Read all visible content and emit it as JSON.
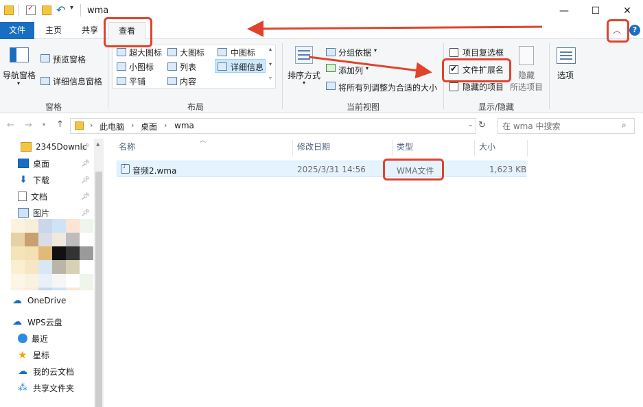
{
  "window": {
    "title": "wma",
    "minimize_glyph": "—",
    "maximize_glyph": "☐",
    "close_glyph": "✕"
  },
  "tabs": [
    {
      "label": "文件"
    },
    {
      "label": "主页"
    },
    {
      "label": "共享"
    },
    {
      "label": "查看"
    }
  ],
  "ribbon": {
    "panes": {
      "nav_pane": "导航窗格",
      "preview_pane": "预览窗格",
      "details_pane": "详细信息窗格",
      "label": "窗格"
    },
    "layout": {
      "items": [
        "超大图标",
        "大图标",
        "中图标",
        "小图标",
        "列表",
        "详细信息",
        "平铺",
        "内容"
      ],
      "label": "布局"
    },
    "current_view": {
      "sort_by": "排序方式",
      "group_by": "分组依据",
      "add_columns": "添加列",
      "fit_columns": "将所有列调整为合适的大小",
      "label": "当前视图"
    },
    "show_hide": {
      "item_checkboxes": "项目复选框",
      "file_extensions": "文件扩展名",
      "hidden_items": "隐藏的项目",
      "hide_selected_line1": "隐藏",
      "hide_selected_line2": "所选项目",
      "label": "显示/隐藏",
      "item_checkboxes_checked": false,
      "file_extensions_checked": true,
      "hidden_items_checked": false
    },
    "options": "选项"
  },
  "nav": {
    "breadcrumb": [
      "此电脑",
      "桌面",
      "wma"
    ],
    "search_placeholder": "在 wma 中搜索"
  },
  "sidebar": {
    "quick": [
      {
        "label": "2345Downlc",
        "icon": "folder-icon"
      },
      {
        "label": "桌面",
        "icon": "desktop-icon"
      },
      {
        "label": "下载",
        "icon": "download-icon"
      },
      {
        "label": "文档",
        "icon": "document-icon"
      },
      {
        "label": "图片",
        "icon": "pictures-icon"
      }
    ],
    "others": [
      {
        "label": "OneDrive",
        "icon": "cloud-icon"
      },
      {
        "label": "WPS云盘",
        "icon": "cloud-icon"
      },
      {
        "label": "最近",
        "icon": "clock-icon"
      },
      {
        "label": "星标",
        "icon": "star-icon"
      },
      {
        "label": "我的云文档",
        "icon": "cloud-doc-icon"
      },
      {
        "label": "共享文件夹",
        "icon": "share-icon"
      }
    ]
  },
  "columns": [
    "名称",
    "修改日期",
    "类型",
    "大小"
  ],
  "files": [
    {
      "name": "音频2.wma",
      "modified": "2025/3/31 14:56",
      "type": "WMA文件",
      "size": "1,623 KB"
    }
  ],
  "colors": {
    "accent": "#1a6ec1",
    "annotation": "#e0432d",
    "selection": "#e5f3ff"
  }
}
